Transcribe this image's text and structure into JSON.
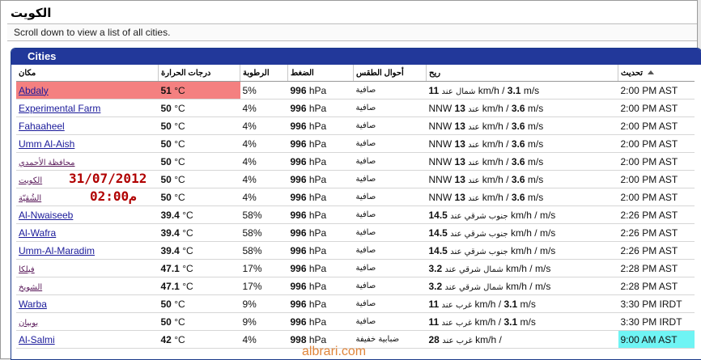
{
  "page": {
    "title": "الكويت",
    "subtitle": "Scroll down to view a list of all cities."
  },
  "panel": {
    "title": "Cities"
  },
  "columns": [
    "مكان",
    "درجات الحرارة",
    "الرطوبة",
    "الضغط",
    "أحوال الطقس",
    "ريح",
    "تحديث"
  ],
  "rows": [
    {
      "city": "Abdaly",
      "temp": "51",
      "temp_unit": "°C",
      "humidity": "5%",
      "pressure": "996",
      "pressure_unit": "hPa",
      "condition": "صافية",
      "wind_dir": "شمال عند",
      "wind_kmh": "11",
      "wind_ms": "3.1",
      "updated": "2:00 PM AST",
      "highlight": "red"
    },
    {
      "city": "Experimental Farm",
      "temp": "50",
      "temp_unit": "°C",
      "humidity": "4%",
      "pressure": "996",
      "pressure_unit": "hPa",
      "condition": "صافية",
      "wind_dir": "NNW",
      "wind_kmh": "13",
      "wind_ms": "3.6",
      "updated": "2:00 PM AST"
    },
    {
      "city": "Fahaaheel",
      "temp": "50",
      "temp_unit": "°C",
      "humidity": "4%",
      "pressure": "996",
      "pressure_unit": "hPa",
      "condition": "صافية",
      "wind_dir": "NNW",
      "wind_kmh": "13",
      "wind_ms": "3.6",
      "updated": "2:00 PM AST"
    },
    {
      "city": "Umm Al-Aish",
      "temp": "50",
      "temp_unit": "°C",
      "humidity": "4%",
      "pressure": "996",
      "pressure_unit": "hPa",
      "condition": "صافية",
      "wind_dir": "NNW",
      "wind_kmh": "13",
      "wind_ms": "3.6",
      "updated": "2:00 PM AST"
    },
    {
      "city": "محافظة الأحمدي",
      "temp": "50",
      "temp_unit": "°C",
      "humidity": "4%",
      "pressure": "996",
      "pressure_unit": "hPa",
      "condition": "صافية",
      "wind_dir": "NNW",
      "wind_kmh": "13",
      "wind_ms": "3.6",
      "updated": "2:00 PM AST",
      "arabic": true
    },
    {
      "city": "الكويت",
      "temp": "50",
      "temp_unit": "°C",
      "humidity": "4%",
      "pressure": "996",
      "pressure_unit": "hPa",
      "condition": "صافية",
      "wind_dir": "NNW",
      "wind_kmh": "13",
      "wind_ms": "3.6",
      "updated": "2:00 PM AST",
      "arabic": true
    },
    {
      "city": "الشُقيّة",
      "temp": "50",
      "temp_unit": "°C",
      "humidity": "4%",
      "pressure": "996",
      "pressure_unit": "hPa",
      "condition": "صافية",
      "wind_dir": "NNW",
      "wind_kmh": "13",
      "wind_ms": "3.6",
      "updated": "2:00 PM AST",
      "arabic": true
    },
    {
      "city": "Al-Nwaiseeb",
      "temp": "39.4",
      "temp_unit": "°C",
      "humidity": "58%",
      "pressure": "996",
      "pressure_unit": "hPa",
      "condition": "صافية",
      "wind_dir": "جنوب شرقي عند",
      "wind_kmh": "14.5",
      "wind_ms": "",
      "updated": "2:26 PM AST"
    },
    {
      "city": "Al-Wafra",
      "temp": "39.4",
      "temp_unit": "°C",
      "humidity": "58%",
      "pressure": "996",
      "pressure_unit": "hPa",
      "condition": "صافية",
      "wind_dir": "جنوب شرقي عند",
      "wind_kmh": "14.5",
      "wind_ms": "",
      "updated": "2:26 PM AST"
    },
    {
      "city": "Umm-Al-Maradim",
      "temp": "39.4",
      "temp_unit": "°C",
      "humidity": "58%",
      "pressure": "996",
      "pressure_unit": "hPa",
      "condition": "صافية",
      "wind_dir": "جنوب شرقي عند",
      "wind_kmh": "14.5",
      "wind_ms": "",
      "updated": "2:26 PM AST"
    },
    {
      "city": "فيلكا",
      "temp": "47.1",
      "temp_unit": "°C",
      "humidity": "17%",
      "pressure": "996",
      "pressure_unit": "hPa",
      "condition": "صافية",
      "wind_dir": "شمال شرقي عند",
      "wind_kmh": "3.2",
      "wind_ms": "",
      "updated": "2:28 PM AST",
      "arabic": true
    },
    {
      "city": "الشويخ",
      "temp": "47.1",
      "temp_unit": "°C",
      "humidity": "17%",
      "pressure": "996",
      "pressure_unit": "hPa",
      "condition": "صافية",
      "wind_dir": "شمال شرقي عند",
      "wind_kmh": "3.2",
      "wind_ms": "",
      "updated": "2:28 PM AST",
      "arabic": true
    },
    {
      "city": "Warba",
      "temp": "50",
      "temp_unit": "°C",
      "humidity": "9%",
      "pressure": "996",
      "pressure_unit": "hPa",
      "condition": "صافية",
      "wind_dir": "غرب عند",
      "wind_kmh": "11",
      "wind_ms": "3.1",
      "updated": "3:30 PM IRDT"
    },
    {
      "city": "بوبيان",
      "temp": "50",
      "temp_unit": "°C",
      "humidity": "9%",
      "pressure": "996",
      "pressure_unit": "hPa",
      "condition": "صافية",
      "wind_dir": "غرب عند",
      "wind_kmh": "11",
      "wind_ms": "3.1",
      "updated": "3:30 PM IRDT",
      "arabic": true
    },
    {
      "city": "Al-Salmi",
      "temp": "42",
      "temp_unit": "°C",
      "humidity": "4%",
      "pressure": "998",
      "pressure_unit": "hPa",
      "condition": "ضبابية خفيفة",
      "wind_dir": "غرب عند",
      "wind_kmh": "28",
      "wind_ms": "",
      "updated": "9:00 AM AST",
      "highlight_updated": "cyan"
    }
  ],
  "units": {
    "kmh": "km/h",
    "ms": "m/s"
  },
  "stamp": {
    "date": "31/07/2012",
    "time": "02:00م"
  },
  "watermark": "albrari.com",
  "colors": {
    "header_bg": "#22389a",
    "highlight_red": "#f48080",
    "highlight_cyan": "#6ff4f4"
  }
}
